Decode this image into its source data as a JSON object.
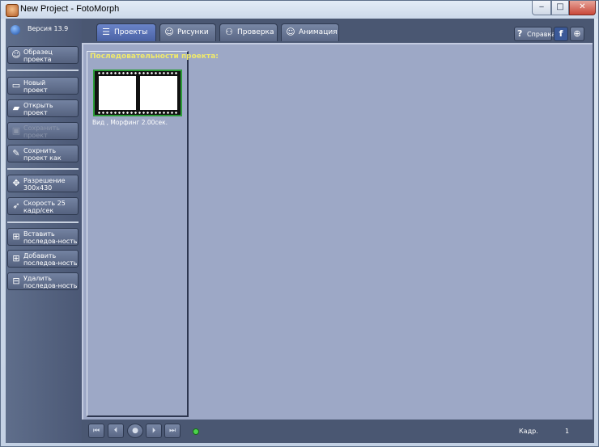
{
  "window": {
    "title": "New Project - FotoMorph",
    "minimize": "‒",
    "maximize": "□",
    "close": "✕"
  },
  "sidebar": {
    "version": "Версия 13.9",
    "buttons": [
      {
        "label": "Образец\nпроекта",
        "icon": "portrait-icon",
        "glyph": "☺",
        "enabled": true
      },
      {
        "label": "Новый\nпроект",
        "icon": "new-document-icon",
        "glyph": "▭",
        "enabled": true
      },
      {
        "label": "Открыть\nпроект",
        "icon": "open-folder-icon",
        "glyph": "▰",
        "enabled": true
      },
      {
        "label": "Сохранить\nпроект",
        "icon": "save-icon",
        "glyph": "▣",
        "enabled": false
      },
      {
        "label": "Сохрнить\nпроект как",
        "icon": "save-as-icon",
        "glyph": "✎",
        "enabled": true
      },
      {
        "label": "Разрешение\n300x430",
        "icon": "resize-icon",
        "glyph": "✥",
        "enabled": true
      },
      {
        "label": "Скорость 25\nкадр/сек",
        "icon": "speed-icon",
        "glyph": "➶",
        "enabled": true
      },
      {
        "label": "Вставить\nпоследов-ность",
        "icon": "insert-sequence-icon",
        "glyph": "⊞",
        "enabled": true
      },
      {
        "label": "Добавить\nпоследов-ность",
        "icon": "add-sequence-icon",
        "glyph": "⊞",
        "enabled": true
      },
      {
        "label": "Удалить\nпоследов-ность",
        "icon": "delete-sequence-icon",
        "glyph": "⊟",
        "enabled": true
      }
    ]
  },
  "tabs": [
    {
      "label": "Проекты",
      "icon": "projects-icon",
      "glyph": "☰",
      "active": true
    },
    {
      "label": "Рисунки",
      "icon": "pictures-icon",
      "glyph": "☺",
      "active": false
    },
    {
      "label": "Проверка",
      "icon": "review-icon",
      "glyph": "⚇",
      "active": false
    },
    {
      "label": "Анимация",
      "icon": "animation-icon",
      "glyph": "☺",
      "active": false
    }
  ],
  "toolbar_right": {
    "help_label": "Справка",
    "help_glyph": "?",
    "facebook_glyph": "f",
    "web_glyph": "⊕"
  },
  "main": {
    "sequences_title": "Последовательности проекта:",
    "sequence_caption": "Вид  ,   Морфинг 2.00сек."
  },
  "bottom": {
    "controls": [
      "⏮",
      "⏴",
      "●",
      "⏵",
      "⏭"
    ],
    "frame_label": "Кадр.",
    "frame_value": "1"
  },
  "colors": {
    "work_area": "#9da8c6",
    "title_yellow": "#f0ea6a",
    "film_border": "#2c9c39"
  }
}
